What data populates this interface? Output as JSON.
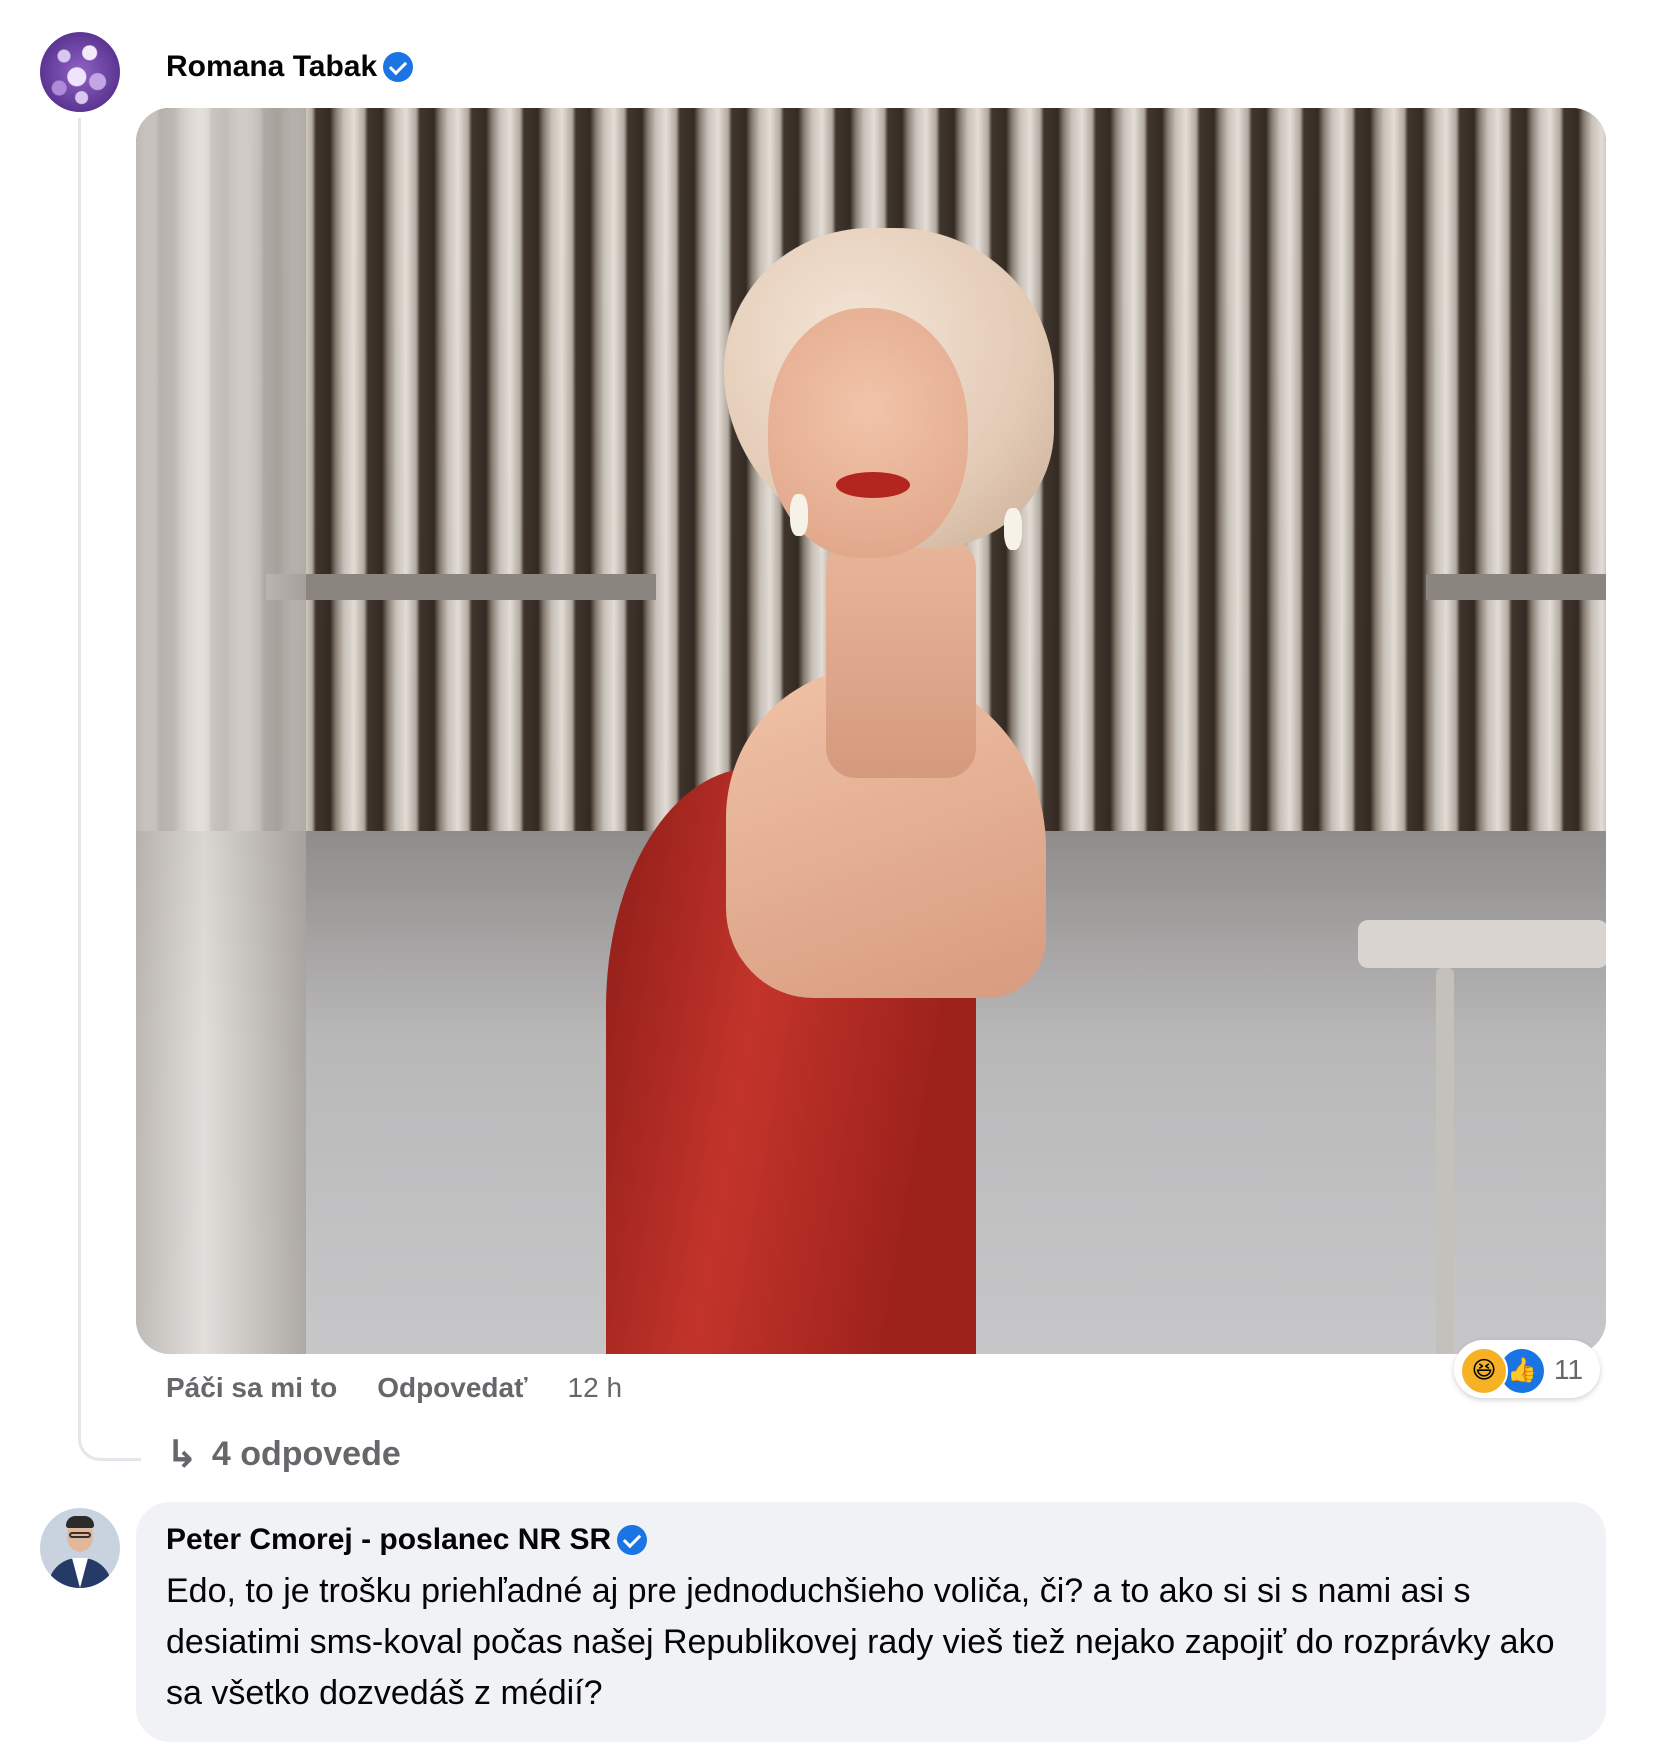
{
  "comments": [
    {
      "author": "Romana Tabak",
      "verified": true,
      "actions": {
        "like": "Páči sa mi to",
        "reply": "Odpovedať",
        "time": "12 h"
      },
      "reactions": {
        "icons": [
          "haha-icon",
          "like-icon"
        ],
        "count": "11"
      },
      "replies_label": "4 odpovede"
    },
    {
      "author": "Peter Cmorej - poslanec NR SR",
      "verified": true,
      "text": "Edo, to je trošku priehľadné aj pre jednoduchšieho voliča, či? a to ako si si s nami asi s desiatimi sms-koval počas našej Republikovej rady vieš tiež nejako zapojiť do rozprávky ako sa všetko dozvedáš z médií?"
    }
  ],
  "colors": {
    "accent": "#1b74e4",
    "muted": "#65676b",
    "bubble": "#f0f2f5"
  }
}
